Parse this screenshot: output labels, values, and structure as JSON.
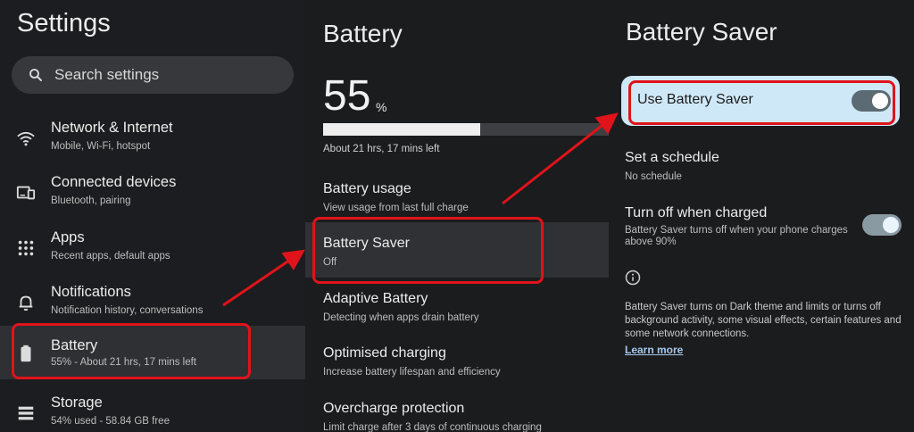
{
  "left": {
    "title": "Settings",
    "search_placeholder": "Search settings",
    "items": [
      {
        "title": "Network & Internet",
        "subtitle": "Mobile, Wi-Fi, hotspot",
        "icon": "wifi-icon"
      },
      {
        "title": "Connected devices",
        "subtitle": "Bluetooth, pairing",
        "icon": "devices-icon"
      },
      {
        "title": "Apps",
        "subtitle": "Recent apps, default apps",
        "icon": "apps-grid-icon"
      },
      {
        "title": "Notifications",
        "subtitle": "Notification history, conversations",
        "icon": "bell-icon"
      },
      {
        "title": "Battery",
        "subtitle": "55% - About 21 hrs, 17 mins left",
        "icon": "battery-icon"
      },
      {
        "title": "Storage",
        "subtitle": "54% used - 58.84 GB free",
        "icon": "storage-icon"
      }
    ]
  },
  "mid": {
    "title": "Battery",
    "percent": "55",
    "percent_unit": "%",
    "level": 0.55,
    "time_left": "About 21 hrs, 17 mins left",
    "rows": [
      {
        "title": "Battery usage",
        "subtitle": "View usage from last full charge"
      },
      {
        "title": "Battery Saver",
        "subtitle": "Off"
      },
      {
        "title": "Adaptive Battery",
        "subtitle": "Detecting when apps drain battery"
      },
      {
        "title": "Optimised charging",
        "subtitle": "Increase battery lifespan and efficiency"
      },
      {
        "title": "Overcharge protection",
        "subtitle": "Limit charge after 3 days of continuous charging"
      }
    ]
  },
  "right": {
    "title": "Battery Saver",
    "use_label": "Use Battery Saver",
    "use_on": true,
    "schedule_title": "Set a schedule",
    "schedule_subtitle": "No schedule",
    "turnoff_title": "Turn off when charged",
    "turnoff_subtitle": "Battery Saver turns off when your phone charges above 90%",
    "turnoff_on": true,
    "info_text": "Battery Saver turns on Dark theme and limits or turns off background activity, some visual effects, certain features and some network connections.",
    "learn_more": "Learn more"
  },
  "colors": {
    "annotation": "#e1131a",
    "highlight_card": "#cfe8f8"
  }
}
